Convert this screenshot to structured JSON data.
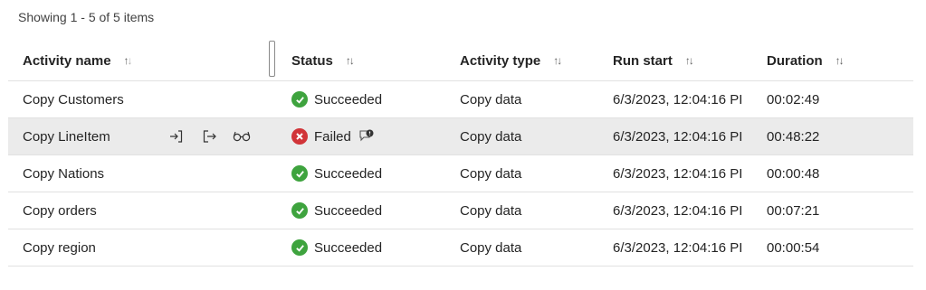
{
  "summary": "Showing 1 - 5 of 5 items",
  "columns": {
    "name": "Activity name",
    "status": "Status",
    "type": "Activity type",
    "run": "Run start",
    "duration": "Duration"
  },
  "rows": [
    {
      "name": "Copy Customers",
      "status": "Succeeded",
      "type": "Copy data",
      "run": "6/3/2023, 12:04:16 PI",
      "duration": "00:02:49"
    },
    {
      "name": "Copy LineItem",
      "status": "Failed",
      "type": "Copy data",
      "run": "6/3/2023, 12:04:16 PI",
      "duration": "00:48:22"
    },
    {
      "name": "Copy Nations",
      "status": "Succeeded",
      "type": "Copy data",
      "run": "6/3/2023, 12:04:16 PI",
      "duration": "00:00:48"
    },
    {
      "name": "Copy orders",
      "status": "Succeeded",
      "type": "Copy data",
      "run": "6/3/2023, 12:04:16 PI",
      "duration": "00:07:21"
    },
    {
      "name": "Copy region",
      "status": "Succeeded",
      "type": "Copy data",
      "run": "6/3/2023, 12:04:16 PI",
      "duration": "00:00:54"
    }
  ],
  "colors": {
    "success": "#3ea33e",
    "failure": "#d13438",
    "selected_row": "#ebebeb"
  }
}
